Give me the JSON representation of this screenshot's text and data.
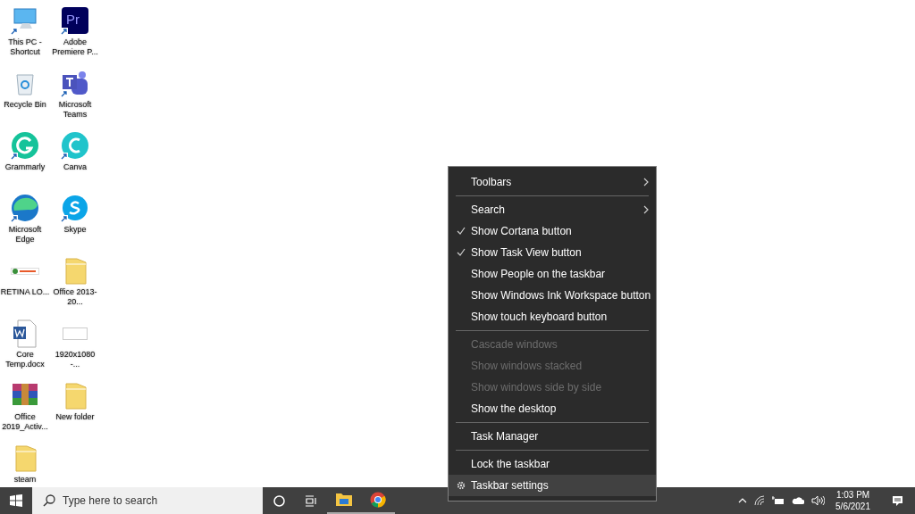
{
  "desktop_icons": [
    {
      "label": "This PC - Shortcut",
      "kind": "pc",
      "shortcut": true
    },
    {
      "label": "Recycle Bin",
      "kind": "bin",
      "shortcut": false
    },
    {
      "label": "Grammarly",
      "kind": "grammarly",
      "shortcut": true
    },
    {
      "label": "Microsoft Edge",
      "kind": "edge",
      "shortcut": true
    },
    {
      "label": "RETINA LO...",
      "kind": "image",
      "shortcut": false
    },
    {
      "label": "Core Temp.docx",
      "kind": "word",
      "shortcut": false
    },
    {
      "label": "Office 2019_Activ...",
      "kind": "rar",
      "shortcut": false
    },
    {
      "label": "steam",
      "kind": "folder",
      "shortcut": false
    },
    {
      "label": "Adobe Premiere P...",
      "kind": "pr",
      "shortcut": true,
      "logo_text": "Pr"
    },
    {
      "label": "Microsoft Teams",
      "kind": "teams",
      "shortcut": true
    },
    {
      "label": "Canva",
      "kind": "canva",
      "shortcut": true
    },
    {
      "label": "Skype",
      "kind": "skype",
      "shortcut": true
    },
    {
      "label": "Office 2013-20...",
      "kind": "folder",
      "shortcut": false
    },
    {
      "label": "1920x1080 -...",
      "kind": "blank",
      "shortcut": false
    },
    {
      "label": "New folder",
      "kind": "folder",
      "shortcut": false
    }
  ],
  "context_menu": [
    {
      "kind": "item",
      "label": "Toolbars",
      "checked": false,
      "disabled": false,
      "submenu": true,
      "selected": false,
      "gear": false
    },
    {
      "kind": "separator"
    },
    {
      "kind": "item",
      "label": "Search",
      "checked": false,
      "disabled": false,
      "submenu": true,
      "selected": false,
      "gear": false
    },
    {
      "kind": "item",
      "label": "Show Cortana button",
      "checked": true,
      "disabled": false,
      "submenu": false,
      "selected": false,
      "gear": false
    },
    {
      "kind": "item",
      "label": "Show Task View button",
      "checked": true,
      "disabled": false,
      "submenu": false,
      "selected": false,
      "gear": false
    },
    {
      "kind": "item",
      "label": "Show People on the taskbar",
      "checked": false,
      "disabled": false,
      "submenu": false,
      "selected": false,
      "gear": false
    },
    {
      "kind": "item",
      "label": "Show Windows Ink Workspace button",
      "checked": false,
      "disabled": false,
      "submenu": false,
      "selected": false,
      "gear": false
    },
    {
      "kind": "item",
      "label": "Show touch keyboard button",
      "checked": false,
      "disabled": false,
      "submenu": false,
      "selected": false,
      "gear": false
    },
    {
      "kind": "separator"
    },
    {
      "kind": "item",
      "label": "Cascade windows",
      "checked": false,
      "disabled": true,
      "submenu": false,
      "selected": false,
      "gear": false
    },
    {
      "kind": "item",
      "label": "Show windows stacked",
      "checked": false,
      "disabled": true,
      "submenu": false,
      "selected": false,
      "gear": false
    },
    {
      "kind": "item",
      "label": "Show windows side by side",
      "checked": false,
      "disabled": true,
      "submenu": false,
      "selected": false,
      "gear": false
    },
    {
      "kind": "item",
      "label": "Show the desktop",
      "checked": false,
      "disabled": false,
      "submenu": false,
      "selected": false,
      "gear": false
    },
    {
      "kind": "separator"
    },
    {
      "kind": "item",
      "label": "Task Manager",
      "checked": false,
      "disabled": false,
      "submenu": false,
      "selected": false,
      "gear": false
    },
    {
      "kind": "separator"
    },
    {
      "kind": "item",
      "label": "Lock the taskbar",
      "checked": false,
      "disabled": false,
      "submenu": false,
      "selected": false,
      "gear": false
    },
    {
      "kind": "item",
      "label": "Taskbar settings",
      "checked": false,
      "disabled": false,
      "submenu": false,
      "selected": true,
      "gear": true
    }
  ],
  "taskbar": {
    "search_placeholder": "Type here to search",
    "apps": [
      {
        "kind": "explorer",
        "running": true
      },
      {
        "kind": "chrome",
        "running": true
      }
    ],
    "time": "1:03 PM",
    "date": "5/6/2021"
  }
}
